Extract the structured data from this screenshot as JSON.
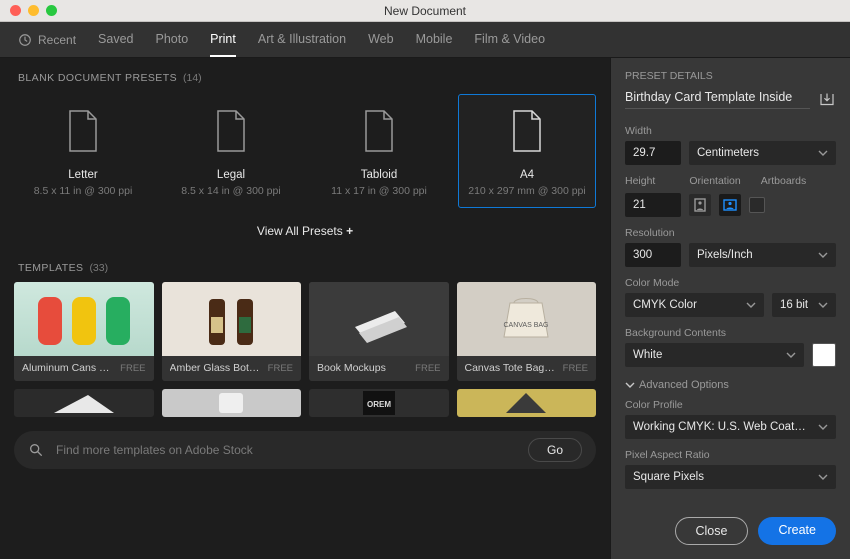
{
  "window": {
    "title": "New Document"
  },
  "tabs": {
    "recent": "Recent",
    "saved": "Saved",
    "items": [
      "Photo",
      "Print",
      "Art & Illustration",
      "Web",
      "Mobile",
      "Film & Video"
    ],
    "active_index": 1
  },
  "blank": {
    "heading": "BLANK DOCUMENT PRESETS",
    "count": "(14)",
    "view_all": "View All Presets",
    "items": [
      {
        "name": "Letter",
        "spec": "8.5 x 11 in @ 300 ppi"
      },
      {
        "name": "Legal",
        "spec": "8.5 x 14 in @ 300 ppi"
      },
      {
        "name": "Tabloid",
        "spec": "11 x 17 in @ 300 ppi"
      },
      {
        "name": "A4",
        "spec": "210 x 297 mm @ 300 ppi"
      }
    ],
    "selected_index": 3
  },
  "templates": {
    "heading": "TEMPLATES",
    "count": "(33)",
    "row1": [
      {
        "name": "Aluminum Cans Moc…",
        "price": "FREE"
      },
      {
        "name": "Amber Glass Bottles…",
        "price": "FREE"
      },
      {
        "name": "Book Mockups",
        "price": "FREE"
      },
      {
        "name": "Canvas Tote Bag Mo…",
        "price": "FREE"
      }
    ]
  },
  "search": {
    "placeholder": "Find more templates on Adobe Stock",
    "go_label": "Go"
  },
  "details": {
    "heading": "PRESET DETAILS",
    "doc_name": "Birthday Card Template Inside",
    "width_label": "Width",
    "width_value": "29.7",
    "unit": "Centimeters",
    "height_label": "Height",
    "height_value": "21",
    "orientation_label": "Orientation",
    "artboards_label": "Artboards",
    "resolution_label": "Resolution",
    "resolution_value": "300",
    "resolution_unit": "Pixels/Inch",
    "color_mode_label": "Color Mode",
    "color_mode": "CMYK Color",
    "color_depth": "16 bit",
    "background_label": "Background Contents",
    "background": "White",
    "advanced_label": "Advanced Options",
    "color_profile_label": "Color Profile",
    "color_profile": "Working CMYK: U.S. Web Coated (S…",
    "pixel_aspect_label": "Pixel Aspect Ratio",
    "pixel_aspect": "Square Pixels"
  },
  "footer": {
    "close": "Close",
    "create": "Create"
  }
}
